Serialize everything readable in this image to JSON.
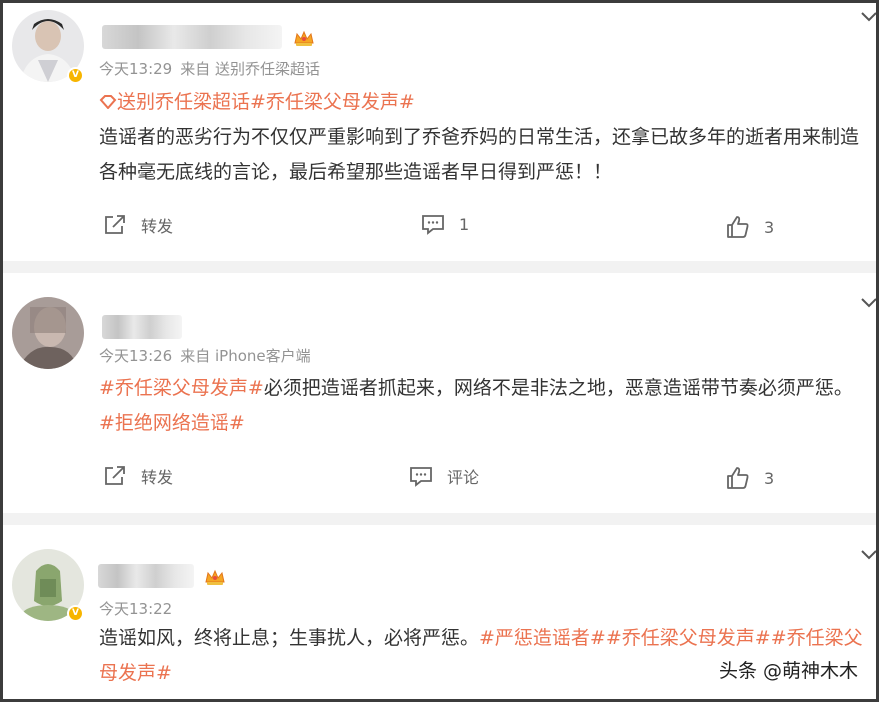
{
  "posts": [
    {
      "time": "今天13:29",
      "source": "来自 送别乔任梁超话",
      "super_topic": "送别乔任梁超话",
      "topic_tag": "#乔任梁父母发声#",
      "text": "造谣者的恶劣行为不仅仅严重影响到了乔爸乔妈的日常生活，还拿已故多年的逝者用来制造各种毫无底线的言论，最后希望那些造谣者早日得到严惩！！",
      "actions": {
        "repost": "转发",
        "comment": "1",
        "like": "3"
      }
    },
    {
      "time": "今天13:26",
      "source": "来自 iPhone客户端",
      "topic_tag_1": "#乔任梁父母发声#",
      "text": "必须把造谣者抓起来，网络不是非法之地，恶意造谣带节奏必须严惩。",
      "topic_tag_2": "#拒绝网络造谣#",
      "actions": {
        "repost": "转发",
        "comment": "评论",
        "like": "3"
      }
    },
    {
      "time": "今天13:22",
      "text": "造谣如风，终将止息；生事扰人，必将严惩。",
      "topic_tags": "#严惩造谣者##乔任梁父母发声##乔任梁父母发声#"
    }
  ],
  "watermark": "头条 @萌神木木",
  "colors": {
    "topic": "#eb7350",
    "meta": "#939393",
    "separator": "#f2f2f2",
    "vbadge": "#f7b500"
  },
  "icons": [
    "repost-icon",
    "comment-icon",
    "like-icon",
    "chevron-down-icon",
    "crown-icon",
    "super-topic-icon"
  ]
}
